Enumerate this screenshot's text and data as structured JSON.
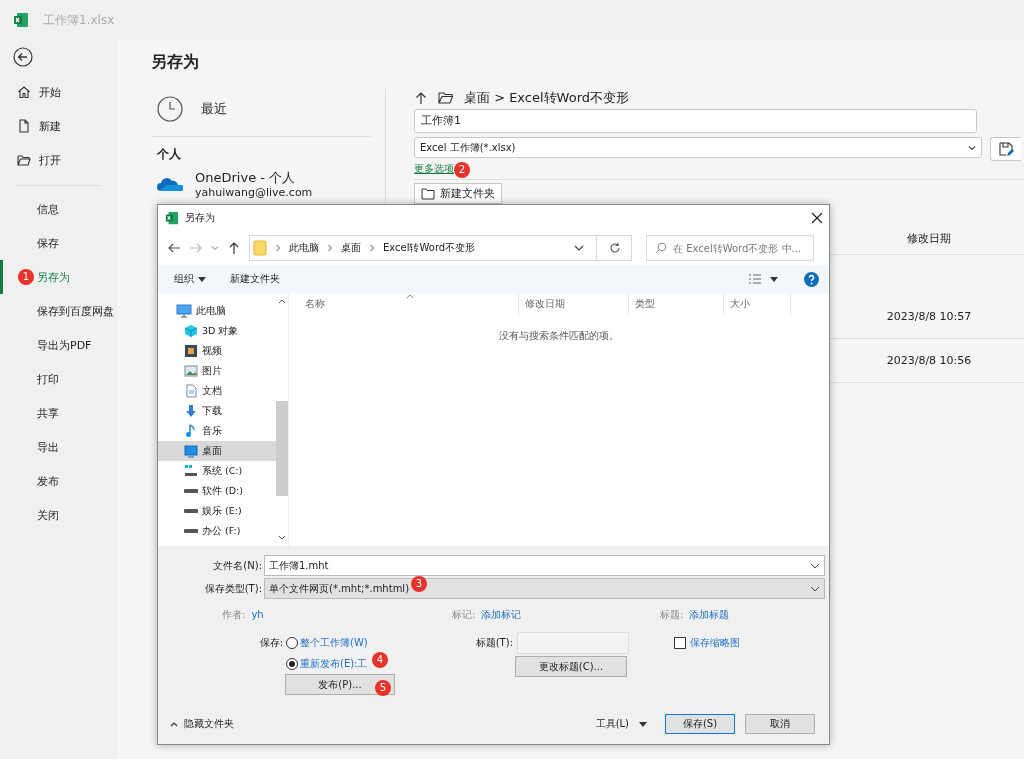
{
  "app": {
    "file_name": "工作簿1.xlsx"
  },
  "sidebar": {
    "top_items": [
      {
        "label": "开始",
        "kind": "home"
      },
      {
        "label": "新建",
        "kind": "new"
      },
      {
        "label": "打开",
        "kind": "open"
      }
    ],
    "items": [
      {
        "label": "信息",
        "selected": false
      },
      {
        "label": "保存",
        "selected": false
      },
      {
        "label": "另存为",
        "selected": true
      },
      {
        "label": "保存到百度网盘",
        "selected": false
      },
      {
        "label": "导出为PDF",
        "selected": false
      },
      {
        "label": "打印",
        "selected": false
      },
      {
        "label": "共享",
        "selected": false
      },
      {
        "label": "导出",
        "selected": false
      },
      {
        "label": "发布",
        "selected": false
      },
      {
        "label": "关闭",
        "selected": false
      }
    ]
  },
  "backstage": {
    "title": "另存为",
    "recent": "最近",
    "personal_heading": "个人",
    "onedrive": {
      "name": "OneDrive - 个人",
      "email": "yahuiwang@live.com"
    },
    "path": "桌面 > Excel转Word不变形",
    "file_name": "工作簿1",
    "file_type": "Excel 工作簿(*.xlsx)",
    "more_options": "更多选项",
    "new_folder": "新建文件夹",
    "column": "修改日期",
    "rows": [
      "2023/8/8 10:57",
      "2023/8/8 10:56"
    ]
  },
  "dialog": {
    "title": "另存为",
    "address": [
      "此电脑",
      "桌面",
      "Excel转Word不变形"
    ],
    "search_placeholder": "在 Excel转Word不变形 中...",
    "toolbar": {
      "organize": "组织",
      "new_folder": "新建文件夹"
    },
    "tree": [
      {
        "label": "此电脑",
        "kind": "pc",
        "selected": false,
        "children": [
          {
            "label": "3D 对象",
            "kind": "cube",
            "selected": false
          },
          {
            "label": "视频",
            "kind": "video",
            "selected": false
          },
          {
            "label": "图片",
            "kind": "picture",
            "selected": false
          },
          {
            "label": "文档",
            "kind": "document",
            "selected": false
          },
          {
            "label": "下载",
            "kind": "download",
            "selected": false
          },
          {
            "label": "音乐",
            "kind": "music",
            "selected": false
          },
          {
            "label": "桌面",
            "kind": "desktop",
            "selected": true
          },
          {
            "label": "系统 (C:)",
            "kind": "system-drive",
            "selected": false
          },
          {
            "label": "软件 (D:)",
            "kind": "drive",
            "selected": false
          },
          {
            "label": "娱乐 (E:)",
            "kind": "drive",
            "selected": false
          },
          {
            "label": "办公 (F:)",
            "kind": "drive",
            "selected": false
          }
        ]
      }
    ],
    "columns": [
      "名称",
      "修改日期",
      "类型",
      "大小"
    ],
    "empty_message": "没有与搜索条件匹配的项。",
    "file_name_label": "文件名(N):",
    "file_name": "工作簿1.mht",
    "file_type_label": "保存类型(T):",
    "file_type": "单个文件网页(*.mht;*.mhtml)",
    "author_label": "作者:",
    "author": "yh",
    "tags_label": "标记:",
    "tags": "添加标记",
    "title_label": "标题:",
    "title_value": "添加标题",
    "save_label": "保存:",
    "save_options": [
      {
        "label": "整个工作簿(W)",
        "selected": false
      },
      {
        "label": "重新发布(E):工",
        "selected": true
      }
    ],
    "publish": "发布(P)...",
    "page_title_label": "标题(T):",
    "change_title": "更改标题(C)...",
    "thumbnail": {
      "label": "保存缩略图",
      "checked": false
    },
    "hide_folders": "隐藏文件夹",
    "tools": "工具(L)",
    "save": "保存(S)",
    "cancel": "取消"
  },
  "badges": [
    {
      "label": "1",
      "kind": "sidebar"
    },
    {
      "label": "2",
      "kind": "more-options"
    },
    {
      "label": "3",
      "kind": "file-type"
    },
    {
      "label": "4",
      "kind": "republish"
    },
    {
      "label": "5",
      "kind": "publish"
    }
  ]
}
